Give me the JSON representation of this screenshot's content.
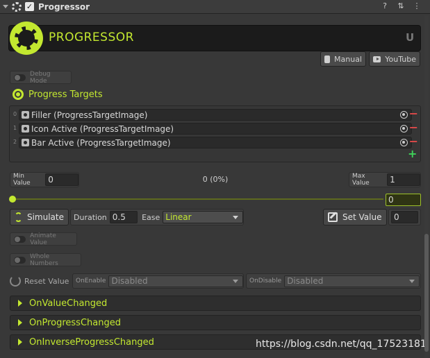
{
  "component": {
    "title": "Progressor",
    "enabled": true
  },
  "banner": {
    "title": "PROGRESSOR",
    "brand_mark": "U"
  },
  "links": {
    "manual": "Manual",
    "youtube": "YouTube"
  },
  "debug": {
    "label": "Debug Mode",
    "enabled": false
  },
  "targets": {
    "title": "Progress Targets",
    "items": [
      {
        "index": "0",
        "label": "Filler (ProgressTargetImage)"
      },
      {
        "index": "1",
        "label": "Icon Active (ProgressTargetImage)"
      },
      {
        "index": "2",
        "label": "Bar Active (ProgressTargetImage)"
      }
    ]
  },
  "range": {
    "min_label": "Min Value",
    "min_value": "0",
    "max_label": "Max Value",
    "max_value": "1",
    "progress_text": "0 (0%)",
    "slider_value": "0",
    "slider_fraction": 0
  },
  "simulate": {
    "button_label": "Simulate",
    "duration_label": "Duration",
    "duration_value": "0.5",
    "ease_label": "Ease",
    "ease_value": "Linear"
  },
  "set_value": {
    "button_label": "Set Value",
    "value": "0"
  },
  "options": {
    "animate_value": "Animate Value",
    "whole_numbers": "Whole Numbers"
  },
  "reset": {
    "label": "Reset Value",
    "on_enable_label": "OnEnable",
    "on_enable_value": "Disabled",
    "on_disable_label": "OnDisable",
    "on_disable_value": "Disabled"
  },
  "events": [
    "OnValueChanged",
    "OnProgressChanged",
    "OnInverseProgressChanged"
  ],
  "watermark": "https://blog.csdn.net/qq_17523181",
  "colors": {
    "accent": "#c3e830",
    "background": "#383838",
    "remove": "#e24a4a",
    "add": "#3fd35a"
  }
}
